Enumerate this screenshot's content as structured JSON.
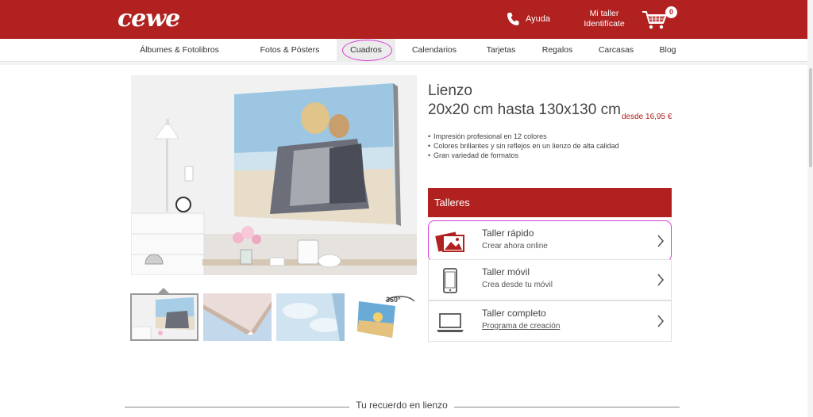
{
  "header": {
    "logo": "cewe",
    "help_label": "Ayuda",
    "account_line1": "Mi taller",
    "account_line2": "Identifícate",
    "cart_count": "0"
  },
  "nav": {
    "items": [
      {
        "label": "Álbumes & Fotolibros"
      },
      {
        "label": "Fotos & Pósters"
      },
      {
        "label": "Cuadros"
      },
      {
        "label": "Calendarios"
      },
      {
        "label": "Tarjetas"
      },
      {
        "label": "Regalos"
      },
      {
        "label": "Carcasas"
      },
      {
        "label": "Blog"
      }
    ],
    "active": "Cuadros"
  },
  "product": {
    "title_line1": "Lienzo",
    "title_line2": "20x20 cm hasta 130x130 cm",
    "price": "desde 16,95 €",
    "features": [
      "Impresión profesional en 12 colores",
      "Colores brillantes y sin reflejos en un lienzo de alta calidad",
      "Gran variedad de formatos"
    ],
    "thumb_360_label": "360°"
  },
  "talleres": {
    "title": "Talleres",
    "items": [
      {
        "title": "Taller rápido",
        "subtitle": "Crear ahora online",
        "icon": "photo-icon"
      },
      {
        "title": "Taller móvil",
        "subtitle": "Crea desde tu móvil",
        "icon": "mobile-icon"
      },
      {
        "title": "Taller completo",
        "subtitle": "Programa de creación",
        "icon": "laptop-icon"
      }
    ]
  },
  "section": {
    "title": "Tu recuerdo en lienzo"
  },
  "colors": {
    "brand": "#b1211f",
    "highlight": "#d43fd3"
  }
}
